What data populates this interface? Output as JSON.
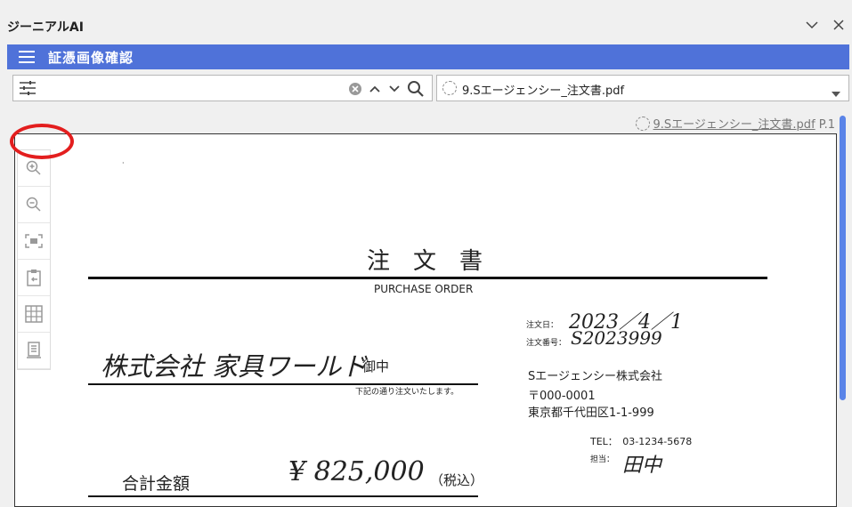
{
  "app": {
    "title": "ジーニアルAI"
  },
  "header": {
    "title": "証憑画像確認"
  },
  "search": {
    "placeholder": ""
  },
  "file_select": {
    "selected": "9.Sエージェンシー_注文書.pdf"
  },
  "viewer": {
    "file_link": "9.Sエージェンシー_注文書.pdf",
    "page_label": "P.1"
  },
  "document": {
    "title": "注　文　書",
    "subtitle": "PURCHASE ORDER",
    "order_date_label": "注文日：",
    "order_date_value": "2023／4／1",
    "order_no_label": "注文番号：",
    "order_no_value": "S2023999",
    "recipient_name": "株式会社 家具ワールド",
    "recipient_suffix": "御中",
    "note": "下記の通り注文いたします。",
    "company": "Sエージェンシー株式会社",
    "postal": "〒000-0001",
    "address": "東京都千代田区1-1-999",
    "tel": "TEL：　03-1234-5678",
    "person_label": "担当：",
    "person_value": "田中",
    "total_label": "合計金額",
    "total_value": "¥ 825,000",
    "tax_note": "（税込）"
  },
  "colors": {
    "header_bg": "#4f72d9",
    "highlight": "#e31e1e",
    "scrollbar": "#5a84e8"
  }
}
